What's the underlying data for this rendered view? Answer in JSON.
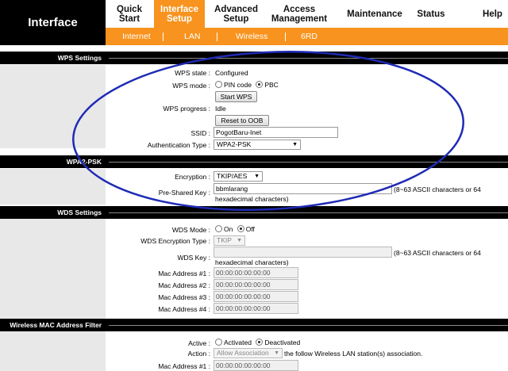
{
  "brand": "Interface",
  "nav": {
    "quick_start": [
      "Quick",
      "Start"
    ],
    "interface_setup": [
      "Interface",
      "Setup"
    ],
    "advanced_setup": [
      "Advanced",
      "Setup"
    ],
    "access_management": [
      "Access",
      "Management"
    ],
    "maintenance": "Maintenance",
    "status": "Status",
    "help": "Help"
  },
  "subnav": {
    "internet": "Internet",
    "lan": "LAN",
    "wireless": "Wireless",
    "sixrd": "6RD"
  },
  "wps": {
    "header": "WPS Settings",
    "state_label": "WPS state :",
    "state_value": "Configured",
    "mode_label": "WPS mode :",
    "mode_pin": "PIN code",
    "mode_pbc": "PBC",
    "start_button": "Start WPS",
    "progress_label": "WPS progress :",
    "progress_value": "Idle",
    "reset_button": "Reset to OOB",
    "ssid_label": "SSID :",
    "ssid_value": "PogotBaru-Inet",
    "auth_label": "Authentication Type :",
    "auth_value": "WPA2-PSK"
  },
  "wpa2": {
    "header": "WPA2-PSK",
    "enc_label": "Encryption :",
    "enc_value": "TKIP/AES",
    "psk_label": "Pre-Shared Key :",
    "psk_value": "bbmlarang",
    "psk_note_a": "(8~63 ASCII characters or 64",
    "psk_note_b": "hexadecimal characters)"
  },
  "wds": {
    "header": "WDS Settings",
    "mode_label": "WDS Mode :",
    "mode_on": "On",
    "mode_off": "Off",
    "enc_label": "WDS Encryption Type :",
    "enc_value": "TKIP",
    "key_label": "WDS Key :",
    "key_value": "",
    "key_note_a": "(8~63 ASCII characters or 64",
    "key_note_b": "hexadecimal characters)",
    "mac1_label": "Mac Address #1 :",
    "mac1": "00:00:00:00:00:00",
    "mac2_label": "Mac Address #2 :",
    "mac2": "00:00:00:00:00:00",
    "mac3_label": "Mac Address #3 :",
    "mac3": "00:00:00:00:00:00",
    "mac4_label": "Mac Address #4 :",
    "mac4": "00:00:00:00:00:00"
  },
  "macfilter": {
    "header": "Wireless MAC Address Filter",
    "active_label": "Active :",
    "activated": "Activated",
    "deactivated": "Deactivated",
    "action_label": "Action :",
    "action_value": "Allow Association",
    "action_suffix": "the follow Wireless LAN station(s) association.",
    "mac1_label": "Mac Address #1 :",
    "mac1": "00:00:00:00:00:00"
  },
  "colors": {
    "accent": "#f7931e",
    "annotation": "#1f2bb5"
  }
}
